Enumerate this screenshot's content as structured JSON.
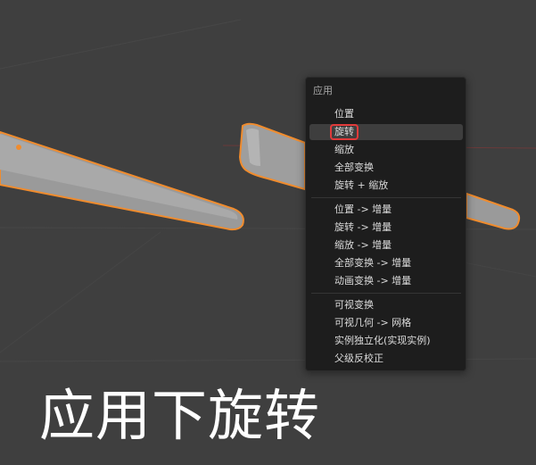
{
  "menu": {
    "title": "应用",
    "groups": [
      {
        "items": [
          {
            "label": "位置"
          },
          {
            "label": "旋转",
            "state": "hovered"
          },
          {
            "label": "缩放"
          },
          {
            "label": "全部变换"
          },
          {
            "label": "旋转 + 缩放"
          }
        ]
      },
      {
        "items": [
          {
            "label": "位置 -> 增量"
          },
          {
            "label": "旋转 -> 增量"
          },
          {
            "label": "缩放 -> 增量"
          },
          {
            "label": "全部变换 -> 增量"
          },
          {
            "label": "动画变换 -> 增量"
          }
        ]
      },
      {
        "items": [
          {
            "label": "可视变换"
          },
          {
            "label": "可视几何 -> 网格"
          },
          {
            "label": "实例独立化(实现实例)"
          },
          {
            "label": "父级反校正"
          }
        ]
      }
    ]
  },
  "caption": "应用下旋转",
  "colors": {
    "background": "#3f3f3f",
    "selection_outline": "#f08c2e",
    "highlight_box": "#e03a3a",
    "mesh_fill": "#9c9c9c"
  }
}
